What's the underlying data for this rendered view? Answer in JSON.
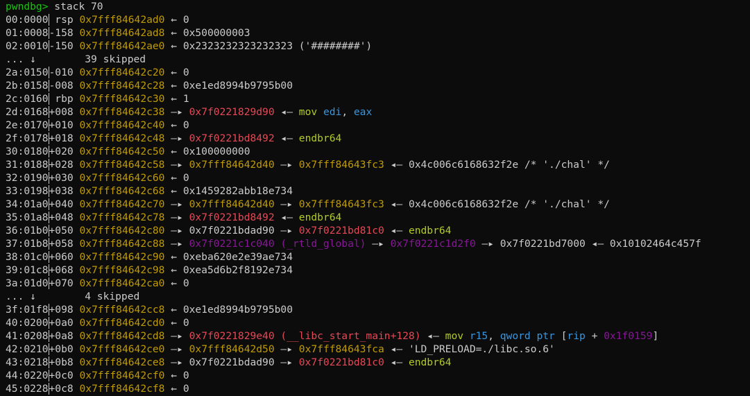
{
  "colors": {
    "background": "#0c0c0c",
    "default": "#cccccc",
    "prompt": "#16c60c",
    "stack": "#c19c00",
    "code": "#e74856",
    "data": "#881798",
    "instr": "#b4cc24",
    "reg": "#3a96dd"
  },
  "lines": [
    {
      "kind": "prompt",
      "prompt": "pwndbg>",
      "command": " stack 70"
    },
    {
      "kind": "entry",
      "index": "00:0000",
      "offset": " rsp ",
      "tokens": [
        [
          "stack",
          "0x7fff84642ad0"
        ],
        [
          "default",
          " ← 0"
        ]
      ]
    },
    {
      "kind": "entry",
      "index": "01:0008",
      "offset": "-158 ",
      "tokens": [
        [
          "stack",
          "0x7fff84642ad8"
        ],
        [
          "default",
          " ← 0x500000003"
        ]
      ]
    },
    {
      "kind": "entry",
      "index": "02:0010",
      "offset": "-150 ",
      "tokens": [
        [
          "stack",
          "0x7fff84642ae0"
        ],
        [
          "default",
          " ← 0x2323232323232323 ('########')"
        ]
      ]
    },
    {
      "kind": "skip",
      "text": "... ↓        39 skipped"
    },
    {
      "kind": "entry",
      "index": "2a:0150",
      "offset": "-010 ",
      "tokens": [
        [
          "stack",
          "0x7fff84642c20"
        ],
        [
          "default",
          " ← 0"
        ]
      ]
    },
    {
      "kind": "entry",
      "index": "2b:0158",
      "offset": "-008 ",
      "tokens": [
        [
          "stack",
          "0x7fff84642c28"
        ],
        [
          "default",
          " ← 0xe1ed8994b9795b00"
        ]
      ]
    },
    {
      "kind": "entry",
      "index": "2c:0160",
      "offset": " rbp ",
      "tokens": [
        [
          "stack",
          "0x7fff84642c30"
        ],
        [
          "default",
          " ← 1"
        ]
      ]
    },
    {
      "kind": "entry",
      "index": "2d:0168",
      "offset": "+008 ",
      "tokens": [
        [
          "stack",
          "0x7fff84642c38"
        ],
        [
          "default",
          " —▸ "
        ],
        [
          "code",
          "0x7f0221829d90"
        ],
        [
          "default",
          " ◂— "
        ],
        [
          "instr",
          "mov "
        ],
        [
          "reg",
          "edi"
        ],
        [
          "default",
          ", "
        ],
        [
          "reg",
          "eax"
        ]
      ]
    },
    {
      "kind": "entry",
      "index": "2e:0170",
      "offset": "+010 ",
      "tokens": [
        [
          "stack",
          "0x7fff84642c40"
        ],
        [
          "default",
          " ← 0"
        ]
      ]
    },
    {
      "kind": "entry",
      "index": "2f:0178",
      "offset": "+018 ",
      "tokens": [
        [
          "stack",
          "0x7fff84642c48"
        ],
        [
          "default",
          " —▸ "
        ],
        [
          "code",
          "0x7f0221bd8492"
        ],
        [
          "default",
          " ◂— "
        ],
        [
          "instr",
          "endbr64"
        ]
      ]
    },
    {
      "kind": "entry",
      "index": "30:0180",
      "offset": "+020 ",
      "tokens": [
        [
          "stack",
          "0x7fff84642c50"
        ],
        [
          "default",
          " ← 0x100000000"
        ]
      ]
    },
    {
      "kind": "entry",
      "index": "31:0188",
      "offset": "+028 ",
      "tokens": [
        [
          "stack",
          "0x7fff84642c58"
        ],
        [
          "default",
          " —▸ "
        ],
        [
          "stack",
          "0x7fff84642d40"
        ],
        [
          "default",
          " —▸ "
        ],
        [
          "stack",
          "0x7fff84643fc3"
        ],
        [
          "default",
          " ◂— 0x4c006c6168632f2e /* './chal' */"
        ]
      ]
    },
    {
      "kind": "entry",
      "index": "32:0190",
      "offset": "+030 ",
      "tokens": [
        [
          "stack",
          "0x7fff84642c60"
        ],
        [
          "default",
          " ← 0"
        ]
      ]
    },
    {
      "kind": "entry",
      "index": "33:0198",
      "offset": "+038 ",
      "tokens": [
        [
          "stack",
          "0x7fff84642c68"
        ],
        [
          "default",
          " ← 0x1459282abb18e734"
        ]
      ]
    },
    {
      "kind": "entry",
      "index": "34:01a0",
      "offset": "+040 ",
      "tokens": [
        [
          "stack",
          "0x7fff84642c70"
        ],
        [
          "default",
          " —▸ "
        ],
        [
          "stack",
          "0x7fff84642d40"
        ],
        [
          "default",
          " —▸ "
        ],
        [
          "stack",
          "0x7fff84643fc3"
        ],
        [
          "default",
          " ◂— 0x4c006c6168632f2e /* './chal' */"
        ]
      ]
    },
    {
      "kind": "entry",
      "index": "35:01a8",
      "offset": "+048 ",
      "tokens": [
        [
          "stack",
          "0x7fff84642c78"
        ],
        [
          "default",
          " —▸ "
        ],
        [
          "code",
          "0x7f0221bd8492"
        ],
        [
          "default",
          " ◂— "
        ],
        [
          "instr",
          "endbr64"
        ]
      ]
    },
    {
      "kind": "entry",
      "index": "36:01b0",
      "offset": "+050 ",
      "tokens": [
        [
          "stack",
          "0x7fff84642c80"
        ],
        [
          "default",
          " —▸ 0x7f0221bdad90 —▸ "
        ],
        [
          "code",
          "0x7f0221bd81c0"
        ],
        [
          "default",
          " ◂— "
        ],
        [
          "instr",
          "endbr64"
        ]
      ]
    },
    {
      "kind": "entry",
      "index": "37:01b8",
      "offset": "+058 ",
      "tokens": [
        [
          "stack",
          "0x7fff84642c88"
        ],
        [
          "default",
          " —▸ "
        ],
        [
          "data",
          "0x7f0221c1c040 (_rtld_global)"
        ],
        [
          "default",
          " —▸ "
        ],
        [
          "data",
          "0x7f0221c1d2f0"
        ],
        [
          "default",
          " —▸ 0x7f0221bd7000 ◂— 0x10102464c457f"
        ]
      ]
    },
    {
      "kind": "entry",
      "index": "38:01c0",
      "offset": "+060 ",
      "tokens": [
        [
          "stack",
          "0x7fff84642c90"
        ],
        [
          "default",
          " ← 0xeba620e2e39ae734"
        ]
      ]
    },
    {
      "kind": "entry",
      "index": "39:01c8",
      "offset": "+068 ",
      "tokens": [
        [
          "stack",
          "0x7fff84642c98"
        ],
        [
          "default",
          " ← 0xea5d6b2f8192e734"
        ]
      ]
    },
    {
      "kind": "entry",
      "index": "3a:01d0",
      "offset": "+070 ",
      "tokens": [
        [
          "stack",
          "0x7fff84642ca0"
        ],
        [
          "default",
          " ← 0"
        ]
      ]
    },
    {
      "kind": "skip",
      "text": "... ↓        4 skipped"
    },
    {
      "kind": "entry",
      "index": "3f:01f8",
      "offset": "+098 ",
      "tokens": [
        [
          "stack",
          "0x7fff84642cc8"
        ],
        [
          "default",
          " ← 0xe1ed8994b9795b00"
        ]
      ]
    },
    {
      "kind": "entry",
      "index": "40:0200",
      "offset": "+0a0 ",
      "tokens": [
        [
          "stack",
          "0x7fff84642cd0"
        ],
        [
          "default",
          " ← 0"
        ]
      ]
    },
    {
      "kind": "entry",
      "index": "41:0208",
      "offset": "+0a8 ",
      "tokens": [
        [
          "stack",
          "0x7fff84642cd8"
        ],
        [
          "default",
          " —▸ "
        ],
        [
          "code",
          "0x7f0221829e40 (__libc_start_main+128)"
        ],
        [
          "default",
          " ◂— "
        ],
        [
          "instr",
          "mov "
        ],
        [
          "reg",
          "r15"
        ],
        [
          "default",
          ", "
        ],
        [
          "reg",
          "qword ptr "
        ],
        [
          "default",
          "["
        ],
        [
          "reg",
          "rip"
        ],
        [
          "default",
          " + "
        ],
        [
          "data",
          "0x1f0159"
        ],
        [
          "default",
          "]"
        ]
      ]
    },
    {
      "kind": "entry",
      "index": "42:0210",
      "offset": "+0b0 ",
      "tokens": [
        [
          "stack",
          "0x7fff84642ce0"
        ],
        [
          "default",
          " —▸ "
        ],
        [
          "stack",
          "0x7fff84642d50"
        ],
        [
          "default",
          " —▸ "
        ],
        [
          "stack",
          "0x7fff84643fca"
        ],
        [
          "default",
          " ◂— 'LD_PRELOAD=./libc.so.6'"
        ]
      ]
    },
    {
      "kind": "entry",
      "index": "43:0218",
      "offset": "+0b8 ",
      "tokens": [
        [
          "stack",
          "0x7fff84642ce8"
        ],
        [
          "default",
          " —▸ 0x7f0221bdad90 —▸ "
        ],
        [
          "code",
          "0x7f0221bd81c0"
        ],
        [
          "default",
          " ◂— "
        ],
        [
          "instr",
          "endbr64"
        ]
      ]
    },
    {
      "kind": "entry",
      "index": "44:0220",
      "offset": "+0c0 ",
      "tokens": [
        [
          "stack",
          "0x7fff84642cf0"
        ],
        [
          "default",
          " ← 0"
        ]
      ]
    },
    {
      "kind": "entry",
      "index": "45:0228",
      "offset": "+0c8 ",
      "tokens": [
        [
          "stack",
          "0x7fff84642cf8"
        ],
        [
          "default",
          " ← 0"
        ]
      ]
    }
  ]
}
